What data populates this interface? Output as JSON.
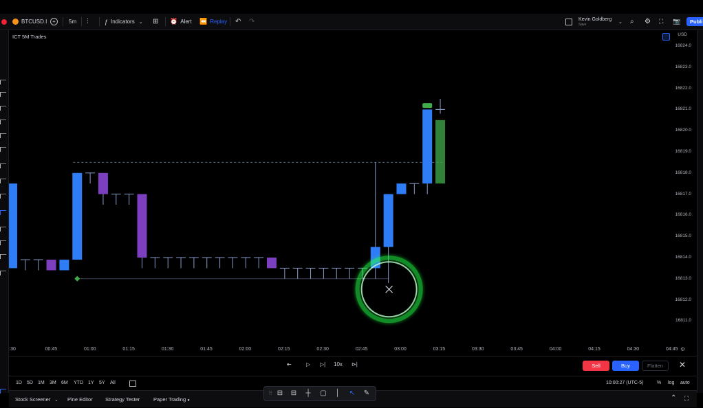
{
  "toolbar": {
    "symbol": "BTCUSD.I",
    "interval": "5m",
    "indicators_label": "Indicators",
    "alert_label": "Alert",
    "replay_label": "Replay",
    "user_name": "Kevin Goldberg",
    "user_sub": "Save",
    "publish_label": "Publi"
  },
  "chart": {
    "indicator_title": "ICT 5M Trades",
    "currency": "USD"
  },
  "colors": {
    "background": "#000000",
    "bull": "#2f7df6",
    "bear": "#7b3fbf",
    "signal": "#3fae49",
    "level_line": "#5a6a8a",
    "ring": "#22ff44"
  },
  "chart_data": {
    "type": "candlestick",
    "ylim": [
      16810.5,
      16824.5
    ],
    "y_ticks": [
      "16824.0",
      "16823.0",
      "16822.0",
      "16821.0",
      "16820.0",
      "16819.0",
      "16818.0",
      "16817.0",
      "16816.0",
      "16815.0",
      "16814.0",
      "16813.0",
      "16812.0",
      "16811.0"
    ],
    "x_ticks": [
      ":30",
      "00:45",
      "01:00",
      "01:15",
      "01:30",
      "01:45",
      "02:00",
      "02:15",
      "02:30",
      "02:45",
      "03:00",
      "03:15",
      "03:30",
      "03:45",
      "04:00",
      "04:15",
      "04:30",
      "04:45"
    ],
    "candles": [
      {
        "time": "00:30",
        "open": 16813.5,
        "high": 16813.6,
        "low": 16813.5,
        "close": 16817.5
      },
      {
        "time": "00:35",
        "open": 16813.9,
        "high": 16813.9,
        "low": 16813.4,
        "close": 16813.9
      },
      {
        "time": "00:40",
        "open": 16813.9,
        "high": 16813.9,
        "low": 16813.4,
        "close": 16813.9
      },
      {
        "time": "00:45",
        "open": 16813.9,
        "high": 16813.9,
        "low": 16813.4,
        "close": 16813.4
      },
      {
        "time": "00:50",
        "open": 16813.4,
        "high": 16813.9,
        "low": 16813.4,
        "close": 16813.9
      },
      {
        "time": "00:55",
        "open": 16813.9,
        "high": 16818.0,
        "low": 16813.9,
        "close": 16818.0
      },
      {
        "time": "01:00",
        "open": 16818.0,
        "high": 16818.0,
        "low": 16817.5,
        "close": 16818.0
      },
      {
        "time": "01:05",
        "open": 16818.0,
        "high": 16818.0,
        "low": 16816.5,
        "close": 16817.0
      },
      {
        "time": "01:10",
        "open": 16817.0,
        "high": 16817.0,
        "low": 16816.5,
        "close": 16817.0
      },
      {
        "time": "01:15",
        "open": 16817.0,
        "high": 16817.0,
        "low": 16816.5,
        "close": 16817.0
      },
      {
        "time": "01:20",
        "open": 16817.0,
        "high": 16817.0,
        "low": 16813.5,
        "close": 16814.0
      },
      {
        "time": "01:25",
        "open": 16814.0,
        "high": 16814.0,
        "low": 16813.5,
        "close": 16814.0
      },
      {
        "time": "01:30",
        "open": 16814.0,
        "high": 16814.0,
        "low": 16813.5,
        "close": 16814.0
      },
      {
        "time": "01:35",
        "open": 16814.0,
        "high": 16814.0,
        "low": 16813.5,
        "close": 16814.0
      },
      {
        "time": "01:40",
        "open": 16814.0,
        "high": 16814.0,
        "low": 16813.5,
        "close": 16814.0
      },
      {
        "time": "01:45",
        "open": 16814.0,
        "high": 16814.0,
        "low": 16813.5,
        "close": 16814.0
      },
      {
        "time": "01:50",
        "open": 16814.0,
        "high": 16814.0,
        "low": 16813.5,
        "close": 16814.0
      },
      {
        "time": "01:55",
        "open": 16814.0,
        "high": 16814.0,
        "low": 16813.5,
        "close": 16814.0
      },
      {
        "time": "02:00",
        "open": 16814.0,
        "high": 16814.0,
        "low": 16813.5,
        "close": 16814.0
      },
      {
        "time": "02:05",
        "open": 16814.0,
        "high": 16814.0,
        "low": 16813.5,
        "close": 16814.0
      },
      {
        "time": "02:10",
        "open": 16814.0,
        "high": 16814.0,
        "low": 16813.5,
        "close": 16813.5
      },
      {
        "time": "02:15",
        "open": 16813.5,
        "high": 16813.5,
        "low": 16813.0,
        "close": 16813.5
      },
      {
        "time": "02:20",
        "open": 16813.5,
        "high": 16813.5,
        "low": 16813.0,
        "close": 16813.5
      },
      {
        "time": "02:25",
        "open": 16813.5,
        "high": 16813.5,
        "low": 16813.0,
        "close": 16813.5
      },
      {
        "time": "02:30",
        "open": 16813.5,
        "high": 16813.5,
        "low": 16813.0,
        "close": 16813.5
      },
      {
        "time": "02:35",
        "open": 16813.5,
        "high": 16813.5,
        "low": 16813.0,
        "close": 16813.5
      },
      {
        "time": "02:40",
        "open": 16813.5,
        "high": 16813.5,
        "low": 16813.0,
        "close": 16813.5
      },
      {
        "time": "02:45",
        "open": 16813.5,
        "high": 16813.5,
        "low": 16813.0,
        "close": 16813.5
      },
      {
        "time": "02:50",
        "open": 16813.5,
        "high": 16818.5,
        "low": 16813.0,
        "close": 16814.5
      },
      {
        "time": "02:55",
        "open": 16814.5,
        "high": 16817.0,
        "low": 16812.8,
        "close": 16817.0
      },
      {
        "time": "03:00",
        "open": 16817.0,
        "high": 16817.5,
        "low": 16817.0,
        "close": 16817.5
      },
      {
        "time": "03:05",
        "open": 16817.5,
        "high": 16817.5,
        "low": 16817.0,
        "close": 16817.5
      },
      {
        "time": "03:10",
        "open": 16817.5,
        "high": 16821.0,
        "low": 16817.0,
        "close": 16821.0
      },
      {
        "time": "03:15",
        "open": 16821.0,
        "high": 16821.5,
        "low": 16820.8,
        "close": 16821.0
      }
    ],
    "level_line_price": 16818.5,
    "signal_box": {
      "top": 16820.5,
      "bottom": 16817.5
    }
  },
  "replay": {
    "speed": "10x"
  },
  "trade": {
    "sell_label": "Sell",
    "buy_label": "Buy",
    "flatten_label": "Flatten"
  },
  "range": {
    "items": [
      "1D",
      "5D",
      "1M",
      "3M",
      "6M",
      "YTD",
      "1Y",
      "5Y",
      "All"
    ],
    "clock": "10:00:27 (UTC-5)",
    "percent": "%",
    "log": "log",
    "auto": "auto"
  },
  "bottom_tabs": [
    "Stock Screener",
    "Pine Editor",
    "Strategy Tester",
    "Paper Trading"
  ]
}
